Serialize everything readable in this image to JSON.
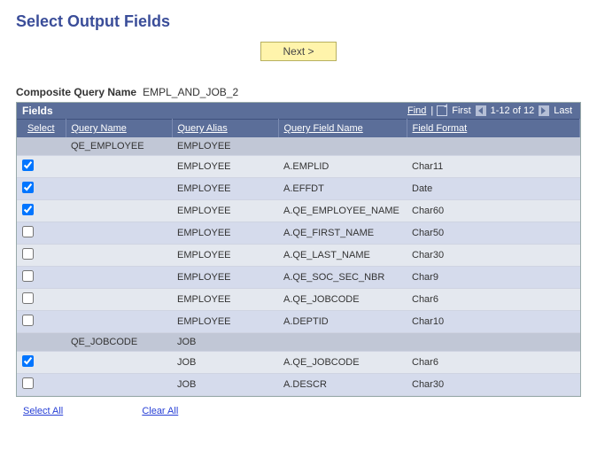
{
  "page": {
    "title": "Select Output Fields",
    "next_label": "Next >",
    "composite_label": "Composite Query Name",
    "composite_value": "EMPL_AND_JOB_2"
  },
  "bar": {
    "title": "Fields",
    "find": "Find",
    "first": "First",
    "range": "1-12 of 12",
    "last": "Last"
  },
  "columns": {
    "select": "Select",
    "query_name": "Query Name",
    "query_alias": "Query Alias",
    "query_field_name": "Query Field Name",
    "field_format": "Field Format"
  },
  "rows": [
    {
      "kind": "header",
      "select": null,
      "query_name": "QE_EMPLOYEE",
      "query_alias": "EMPLOYEE",
      "query_field_name": "",
      "field_format": ""
    },
    {
      "kind": "data",
      "select": true,
      "query_name": "",
      "query_alias": "EMPLOYEE",
      "query_field_name": "A.EMPLID",
      "field_format": "Char11"
    },
    {
      "kind": "data",
      "select": true,
      "query_name": "",
      "query_alias": "EMPLOYEE",
      "query_field_name": "A.EFFDT",
      "field_format": "Date"
    },
    {
      "kind": "data",
      "select": true,
      "query_name": "",
      "query_alias": "EMPLOYEE",
      "query_field_name": "A.QE_EMPLOYEE_NAME",
      "field_format": "Char60"
    },
    {
      "kind": "data",
      "select": false,
      "query_name": "",
      "query_alias": "EMPLOYEE",
      "query_field_name": "A.QE_FIRST_NAME",
      "field_format": "Char50"
    },
    {
      "kind": "data",
      "select": false,
      "query_name": "",
      "query_alias": "EMPLOYEE",
      "query_field_name": "A.QE_LAST_NAME",
      "field_format": "Char30"
    },
    {
      "kind": "data",
      "select": false,
      "query_name": "",
      "query_alias": "EMPLOYEE",
      "query_field_name": "A.QE_SOC_SEC_NBR",
      "field_format": "Char9"
    },
    {
      "kind": "data",
      "select": false,
      "query_name": "",
      "query_alias": "EMPLOYEE",
      "query_field_name": "A.QE_JOBCODE",
      "field_format": "Char6"
    },
    {
      "kind": "data",
      "select": false,
      "query_name": "",
      "query_alias": "EMPLOYEE",
      "query_field_name": "A.DEPTID",
      "field_format": "Char10"
    },
    {
      "kind": "header",
      "select": null,
      "query_name": "QE_JOBCODE",
      "query_alias": "JOB",
      "query_field_name": "",
      "field_format": ""
    },
    {
      "kind": "data",
      "select": true,
      "query_name": "",
      "query_alias": "JOB",
      "query_field_name": "A.QE_JOBCODE",
      "field_format": "Char6"
    },
    {
      "kind": "data",
      "select": false,
      "query_name": "",
      "query_alias": "JOB",
      "query_field_name": "A.DESCR",
      "field_format": "Char30"
    }
  ],
  "footer": {
    "select_all": "Select All",
    "clear_all": "Clear All"
  }
}
